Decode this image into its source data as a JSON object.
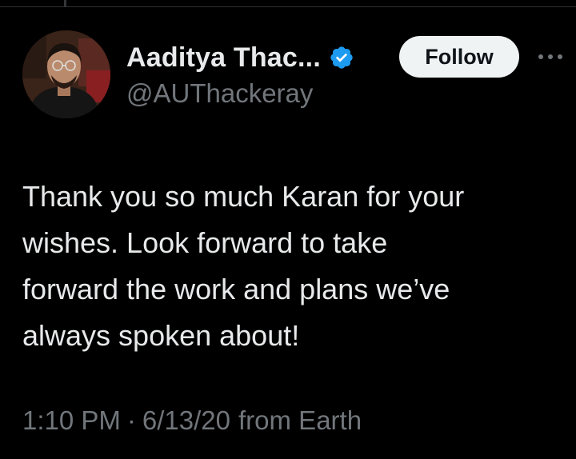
{
  "tweet": {
    "author": {
      "display_name": "Aaditya Thac...",
      "handle": "@AUThackeray",
      "verified": true,
      "avatar": "profile-photo"
    },
    "follow_label": "Follow",
    "more_icon": "more-horizontal-icon",
    "text": "Thank you so much Karan for your\nwishes. Look forward to take\nforward the work and plans we’ve\nalways spoken about!",
    "time": "1:10 PM",
    "separator": "·",
    "date": "6/13/20",
    "source": "from Earth"
  },
  "colors": {
    "background": "#000000",
    "primary_text": "#e7e9ea",
    "secondary_text": "#71767b",
    "verified_blue": "#1d9bf0",
    "follow_bg": "#eff3f4",
    "follow_text": "#0f1419"
  }
}
